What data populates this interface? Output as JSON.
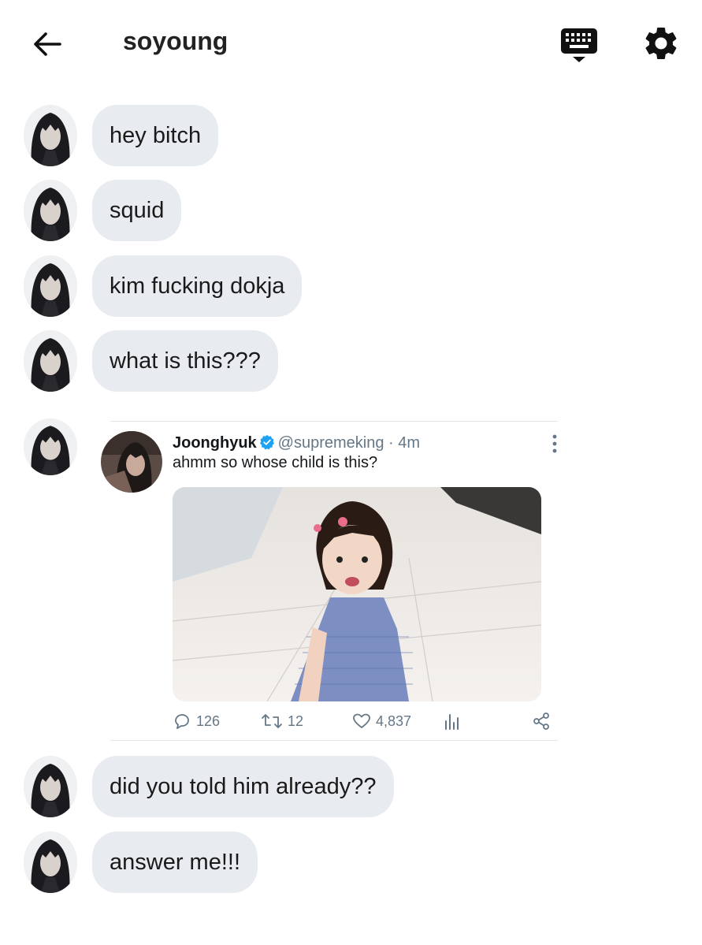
{
  "header": {
    "title": "soyoung",
    "back_icon": "arrow-left-icon",
    "keyboard_icon": "keyboard-icon",
    "settings_icon": "gear-icon"
  },
  "messages": [
    {
      "text": "hey bitch"
    },
    {
      "text": "squid"
    },
    {
      "text": "kim fucking dokja"
    },
    {
      "text": "what is this???"
    },
    {
      "text": "did you told him already??"
    },
    {
      "text": "answer me!!!"
    }
  ],
  "tweet": {
    "name": "Joonghyuk",
    "handle": "@supremeking",
    "time": "4m",
    "separator": "·",
    "text": "ahmm so whose child is this?",
    "replies": "126",
    "retweets": "12",
    "likes": "4,837",
    "verified": true
  },
  "colors": {
    "bubble": "#e8ebef",
    "verified": "#1da1f2",
    "meta": "#657786"
  }
}
